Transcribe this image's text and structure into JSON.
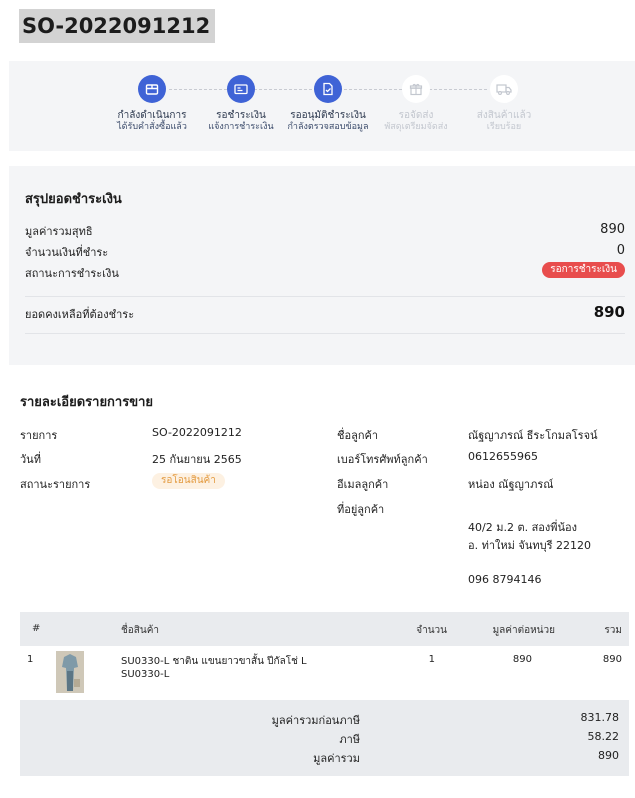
{
  "order": {
    "id": "SO-2022091212"
  },
  "steps": [
    {
      "title": "กำลังดำเนินการ",
      "subtitle": "ได้รับคำสั่งซื้อแล้ว",
      "icon": "box-icon",
      "state": "active"
    },
    {
      "title": "รอชำระเงิน",
      "subtitle": "แจ้งการชำระเงิน",
      "icon": "payment-card-icon",
      "state": "active"
    },
    {
      "title": "รออนุมัติชำระเงิน",
      "subtitle": "กำลังตรวจสอบข้อมูล",
      "icon": "document-check-icon",
      "state": "active"
    },
    {
      "title": "รอจัดส่ง",
      "subtitle": "พัสดุเตรียมจัดส่ง",
      "icon": "gift-box-icon",
      "state": "inactive"
    },
    {
      "title": "ส่งสินค้าแล้ว",
      "subtitle": "เรียบร้อย",
      "icon": "truck-icon",
      "state": "inactive"
    }
  ],
  "summary": {
    "title": "สรุปยอดชำระเงิน",
    "net_total_label": "มูลค่ารวมสุทธิ",
    "net_total_value": "890",
    "paid_label": "จำนวนเงินที่ชำระ",
    "paid_value": "0",
    "payment_status_label": "สถานะการชำระเงิน",
    "payment_status_value": "รอการชำระเงิน",
    "balance_label": "ยอดคงเหลือที่ต้องชำระ",
    "balance_value": "890",
    "status_color": "#e84d4d"
  },
  "details": {
    "title": "รายละเอียดรายการขาย",
    "item_label": "รายการ",
    "item_value": "SO-2022091212",
    "date_label": "วันที่",
    "date_value": "25 กันยายน 2565",
    "status_label": "สถานะรายการ",
    "status_value": "รอโอนสินค้า",
    "customer_name_label": "ชื่อลูกค้า",
    "customer_name_value": "ณัฐญาภรณ์ ธีระโกมลโรจน์",
    "phone_label": "เบอร์โทรศัพท์ลูกค้า",
    "phone_value": "0612655965",
    "email_label": "อีเมลลูกค้า",
    "email_value": "หน่อง ณัฐญาภรณ์",
    "address_label": "ที่อยู่ลูกค้า",
    "address_line1": "40/2 ม.2 ต. สองพี่น้อง",
    "address_line2": "อ. ท่าใหม่ จันทบุรี 22120",
    "address_phone": "096 8794146"
  },
  "table": {
    "headers": {
      "no": "#",
      "name": "ชื่อสินค้า",
      "qty": "จำนวน",
      "unit_price": "มูลค่าต่อหน่วย",
      "total": "รวม"
    },
    "rows": [
      {
        "no": "1",
        "name_line1": "SU0330-L ชาติน แขนยาวขาสั้น ปีกัลโช่ L",
        "name_line2": "SU0330-L",
        "qty": "1",
        "unit_price": "890",
        "total": "890"
      }
    ]
  },
  "totals": {
    "subtotal_label": "มูลค่ารวมก่อนภาษี",
    "subtotal_value": "831.78",
    "tax_label": "ภาษี",
    "tax_value": "58.22",
    "grand_label": "มูลค่ารวม",
    "grand_value": "890"
  },
  "colors": {
    "accent": "#3f63d6",
    "status_red": "#e84d4d",
    "status_orange": "#e39a3f"
  }
}
